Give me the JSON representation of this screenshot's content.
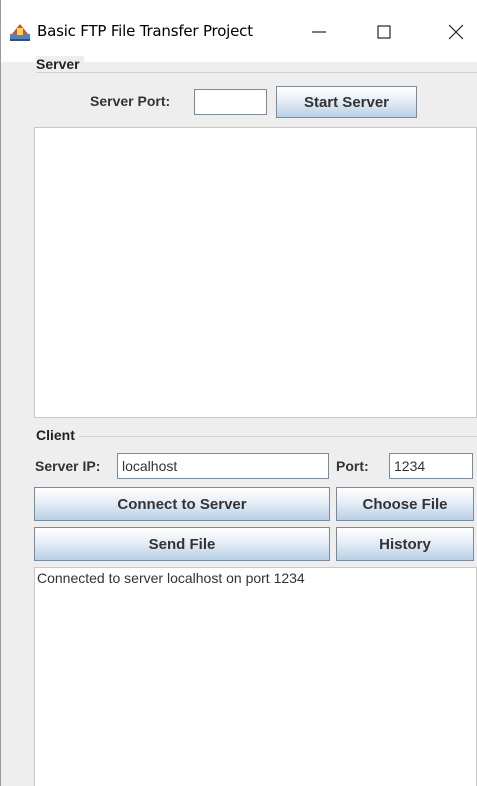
{
  "window": {
    "title": "Basic FTP File Transfer Project",
    "icons": {
      "app": "java-app-icon",
      "minimize": "minimize-icon",
      "maximize": "maximize-icon",
      "close": "close-icon"
    }
  },
  "server": {
    "panel_title": "Server",
    "port_label": "Server Port:",
    "port_value": "",
    "start_button": "Start Server",
    "log_text": ""
  },
  "client": {
    "panel_title": "Client",
    "ip_label": "Server IP:",
    "ip_value": "localhost",
    "port_label": "Port:",
    "port_value": "1234",
    "connect_button": "Connect to Server",
    "choose_button": "Choose File",
    "send_button": "Send File",
    "history_button": "History",
    "log_text": "Connected to server localhost on port 1234"
  },
  "colors": {
    "window_bg": "#eeeeee",
    "button_gradient_bottom": "#b8cfe5",
    "field_border": "#7a8a99"
  }
}
